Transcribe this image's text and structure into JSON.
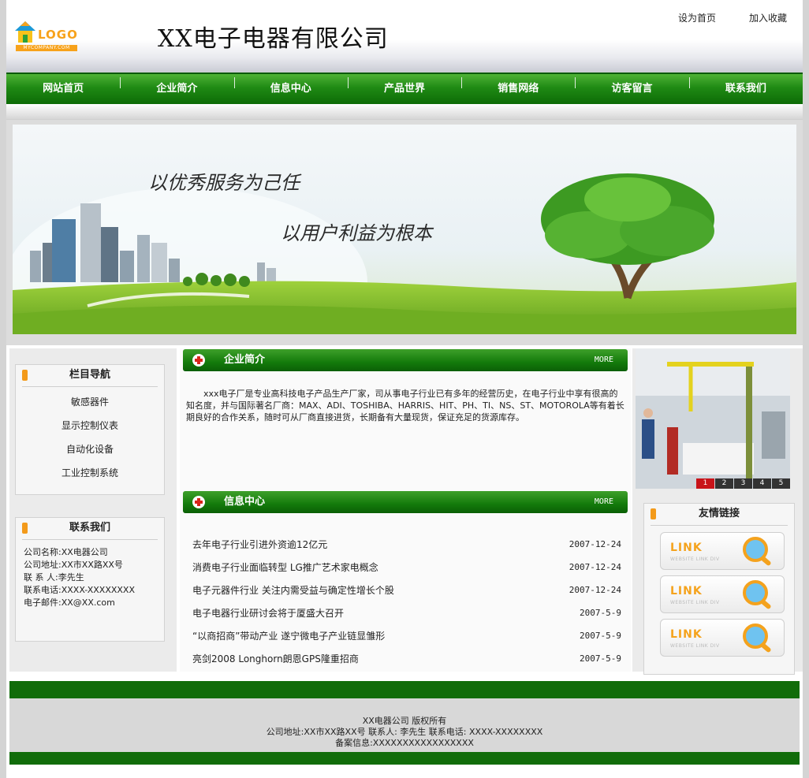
{
  "header": {
    "logo_text": "LOGO",
    "logo_sub": "MYCOMPANY.COM",
    "site_title": "XX电子电器有限公司",
    "top_links": {
      "set_home": "设为首页",
      "add_favorite": "加入收藏"
    }
  },
  "nav": {
    "items": [
      {
        "label": "网站首页"
      },
      {
        "label": "企业简介"
      },
      {
        "label": "信息中心"
      },
      {
        "label": "产品世界"
      },
      {
        "label": "销售网络"
      },
      {
        "label": "访客留言"
      },
      {
        "label": "联系我们"
      }
    ]
  },
  "banner": {
    "slogan_1": "以优秀服务为己任",
    "slogan_2": "以用户利益为根本"
  },
  "sidebar": {
    "column_nav_title": "栏目导航",
    "column_nav_items": [
      {
        "label": "敏感器件"
      },
      {
        "label": "显示控制仪表"
      },
      {
        "label": "自动化设备"
      },
      {
        "label": "工业控制系统"
      }
    ],
    "contact_title": "联系我们",
    "contact_lines": [
      "公司名称:XX电器公司",
      "公司地址:XX市XX路XX号",
      "联 系 人:李先生",
      "联系电话:XXXX-XXXXXXXX",
      "电子邮件:XX@XX.com"
    ]
  },
  "main": {
    "intro_title": "企业简介",
    "more_label": "MORE",
    "intro_text": "xxx电子厂是专业高科技电子产品生产厂家，司从事电子行业已有多年的经营历史，在电子行业中享有很高的知名度，并与国际著名厂商：MAX、ADI、TOSHIBA、HARRIS、HIT、PH、TI、NS、ST、MOTOROLA等有着长期良好的合作关系，随时可从厂商直接进货，长期备有大量现货，保证充足的货源库存。",
    "news_title": "信息中心",
    "news": [
      {
        "title": "去年电子行业引进外资逾12亿元",
        "date": "2007-12-24"
      },
      {
        "title": "消费电子行业面临转型 LG推广艺术家电概念",
        "date": "2007-12-24"
      },
      {
        "title": "电子元器件行业 关注内需受益与确定性增长个股",
        "date": "2007-12-24"
      },
      {
        "title": "电子电器行业研讨会将于厦盛大召开",
        "date": "2007-5-9"
      },
      {
        "title": "“以商招商”带动产业 遂宁微电子产业链显雏形",
        "date": "2007-5-9"
      },
      {
        "title": "亮剑2008 Longhorn朗恩GPS隆重招商",
        "date": "2007-5-9"
      }
    ]
  },
  "right": {
    "pager": [
      "1",
      "2",
      "3",
      "4",
      "5"
    ],
    "links_title": "友情链接",
    "link_label": "LINK",
    "link_sub": "WEBSITE LINK DIV"
  },
  "footer": {
    "line1": "XX电器公司 版权所有",
    "line2": "公司地址:XX市XX路XX号 联系人: 李先生 联系电话: XXXX-XXXXXXXX",
    "line3": "备案信息:XXXXXXXXXXXXXXXXX"
  },
  "colors": {
    "nav_green": "#1f8a14",
    "footer_green": "#116c0a",
    "accent_orange": "#f39a1a"
  }
}
